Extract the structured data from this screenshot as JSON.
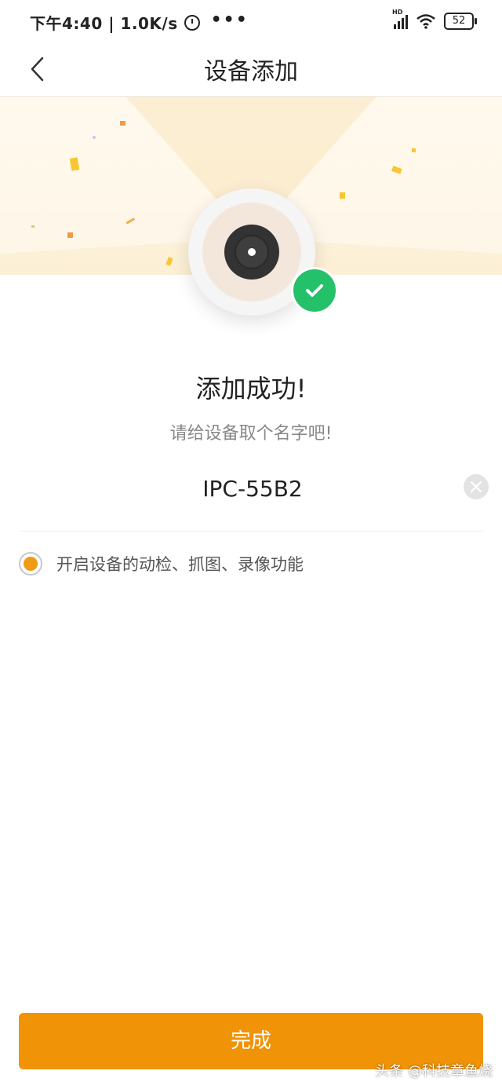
{
  "status_bar": {
    "left_text": "下午4:40 | 1.0K/s",
    "more": "•••",
    "network_tag": "HD",
    "battery": "52"
  },
  "header": {
    "title": "设备添加",
    "back_icon": "chevron-left-icon"
  },
  "hero": {
    "device_icon": "camera-icon",
    "badge_icon": "check-icon",
    "badge_color": "#25c06a"
  },
  "content": {
    "success_title": "添加成功!",
    "subtitle": "请给设备取个名字吧!",
    "device_name_value": "IPC-55B2",
    "option_label": "开启设备的动检、抓图、录像功能",
    "option_checked": true
  },
  "footer": {
    "done_label": "完成",
    "watermark": "头条 @科技章鱼烧"
  },
  "colors": {
    "accent": "#f09306",
    "success": "#25c06a"
  }
}
